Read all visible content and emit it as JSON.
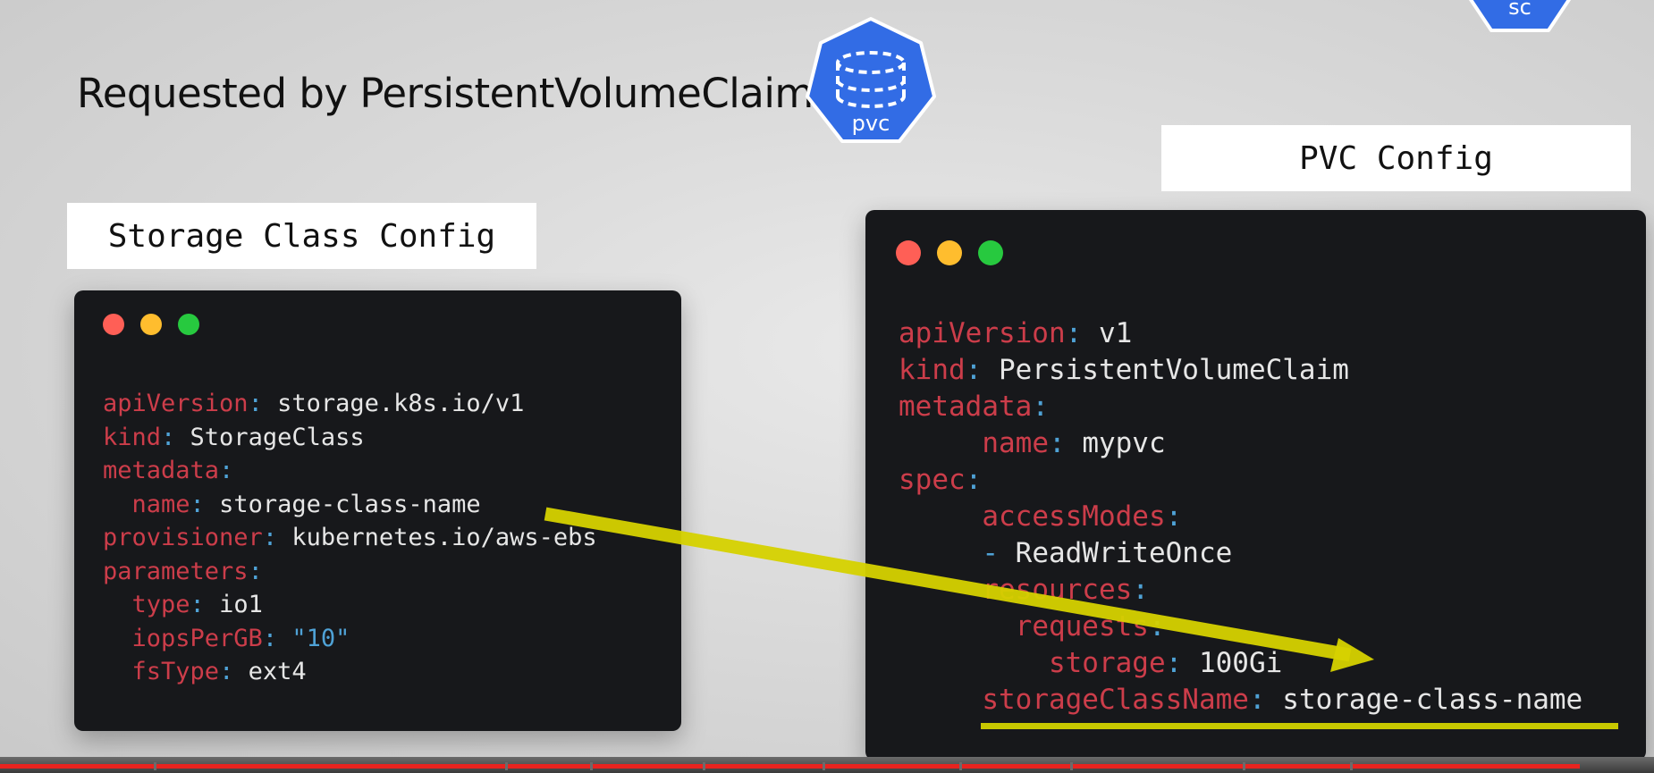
{
  "slide": {
    "title": "Requested by PersistentVolumeClaim",
    "pvc_icon_label": "pvc",
    "sc_icon_label": "sc",
    "badge_color": "#326ce5"
  },
  "left": {
    "label": "Storage Class Config",
    "lines": [
      [
        {
          "t": "k",
          "v": "apiVersion"
        },
        {
          "t": "c",
          "v": ": "
        },
        {
          "t": "v",
          "v": "storage.k8s.io/v1"
        }
      ],
      [
        {
          "t": "k",
          "v": "kind"
        },
        {
          "t": "c",
          "v": ": "
        },
        {
          "t": "v",
          "v": "StorageClass"
        }
      ],
      [
        {
          "t": "k",
          "v": "metadata"
        },
        {
          "t": "c",
          "v": ":"
        }
      ],
      [
        {
          "t": "v",
          "v": "  "
        },
        {
          "t": "k",
          "v": "name"
        },
        {
          "t": "c",
          "v": ": "
        },
        {
          "t": "v",
          "v": "storage-class-name"
        }
      ],
      [
        {
          "t": "k",
          "v": "provisioner"
        },
        {
          "t": "c",
          "v": ": "
        },
        {
          "t": "v",
          "v": "kubernetes.io/aws-ebs"
        }
      ],
      [
        {
          "t": "k",
          "v": "parameters"
        },
        {
          "t": "c",
          "v": ":"
        }
      ],
      [
        {
          "t": "v",
          "v": "  "
        },
        {
          "t": "k",
          "v": "type"
        },
        {
          "t": "c",
          "v": ": "
        },
        {
          "t": "v",
          "v": "io1"
        }
      ],
      [
        {
          "t": "v",
          "v": "  "
        },
        {
          "t": "k",
          "v": "iopsPerGB"
        },
        {
          "t": "c",
          "v": ": "
        },
        {
          "t": "s",
          "v": "\"10\""
        }
      ],
      [
        {
          "t": "v",
          "v": "  "
        },
        {
          "t": "k",
          "v": "fsType"
        },
        {
          "t": "c",
          "v": ": "
        },
        {
          "t": "v",
          "v": "ext4"
        }
      ]
    ]
  },
  "right": {
    "label": "PVC Config",
    "lines": [
      [
        {
          "t": "k",
          "v": "apiVersion"
        },
        {
          "t": "c",
          "v": ": "
        },
        {
          "t": "v",
          "v": "v1"
        }
      ],
      [
        {
          "t": "k",
          "v": "kind"
        },
        {
          "t": "c",
          "v": ": "
        },
        {
          "t": "v",
          "v": "PersistentVolumeClaim"
        }
      ],
      [
        {
          "t": "k",
          "v": "metadata"
        },
        {
          "t": "c",
          "v": ":"
        }
      ],
      [
        {
          "t": "v",
          "v": "     "
        },
        {
          "t": "k",
          "v": "name"
        },
        {
          "t": "c",
          "v": ": "
        },
        {
          "t": "v",
          "v": "mypvc"
        }
      ],
      [
        {
          "t": "k",
          "v": "spec"
        },
        {
          "t": "c",
          "v": ":"
        }
      ],
      [
        {
          "t": "v",
          "v": "     "
        },
        {
          "t": "k",
          "v": "accessModes"
        },
        {
          "t": "c",
          "v": ":"
        }
      ],
      [
        {
          "t": "v",
          "v": "     "
        },
        {
          "t": "c",
          "v": "- "
        },
        {
          "t": "v",
          "v": "ReadWriteOnce"
        }
      ],
      [
        {
          "t": "v",
          "v": "     "
        },
        {
          "t": "k",
          "v": "resources"
        },
        {
          "t": "c",
          "v": ":"
        }
      ],
      [
        {
          "t": "v",
          "v": "       "
        },
        {
          "t": "k",
          "v": "requests"
        },
        {
          "t": "c",
          "v": ":"
        }
      ],
      [
        {
          "t": "v",
          "v": "         "
        },
        {
          "t": "k",
          "v": "storage"
        },
        {
          "t": "c",
          "v": ": "
        },
        {
          "t": "v",
          "v": "100Gi"
        }
      ],
      [
        {
          "t": "v",
          "v": "     "
        },
        {
          "t": "k",
          "v": "storageClassName"
        },
        {
          "t": "c",
          "v": ": "
        },
        {
          "t": "v",
          "v": "storage-class-name"
        }
      ]
    ]
  },
  "colors": {
    "window_red": "#ff5f56",
    "window_yellow": "#ffbd2e",
    "window_green": "#27c93f",
    "highlight_yellow": "#e3e300",
    "progress_red": "#e8231f"
  },
  "video": {
    "progress_fraction": 0.955
  }
}
